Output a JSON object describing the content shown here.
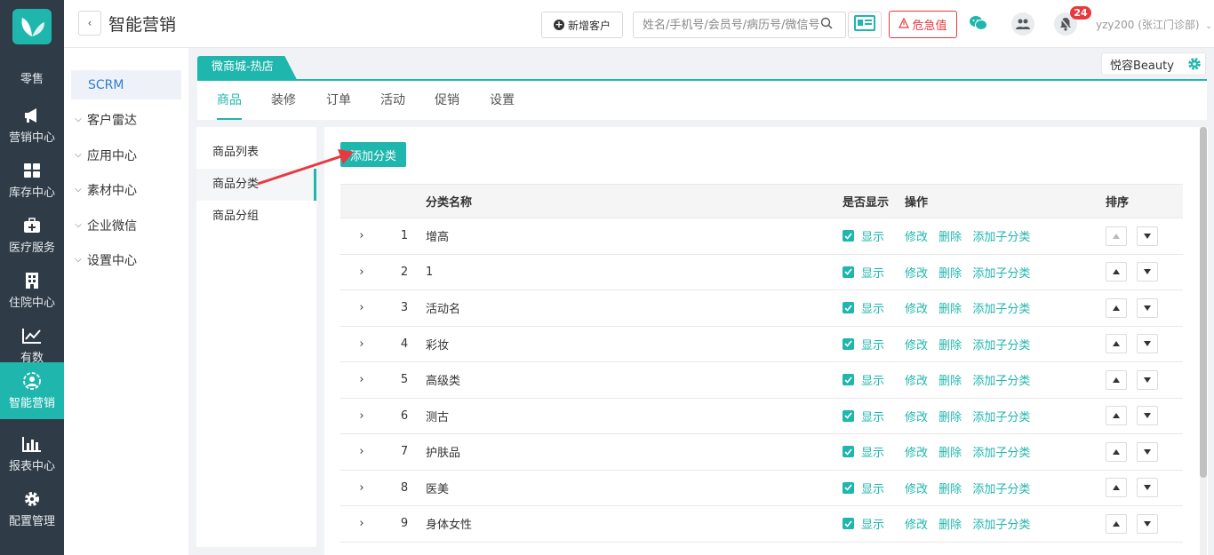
{
  "rail": {
    "items": [
      {
        "label": "零售",
        "icon": "retail-icon"
      },
      {
        "label": "营销中心",
        "icon": "megaphone-icon"
      },
      {
        "label": "库存中心",
        "icon": "grid-icon"
      },
      {
        "label": "医疗服务",
        "icon": "medical-kit-icon"
      },
      {
        "label": "住院中心",
        "icon": "building-icon"
      },
      {
        "label": "有数",
        "icon": "trend-chart-icon"
      },
      {
        "label": "智能营销",
        "icon": "smart-marketing-icon"
      },
      {
        "label": "报表中心",
        "icon": "bar-chart-icon"
      },
      {
        "label": "配置管理",
        "icon": "gear-icon"
      }
    ],
    "active_index": 6,
    "accent": "#1fb6ad"
  },
  "header": {
    "title": "智能营销",
    "new_customer": "新增客户",
    "search_placeholder": "姓名/手机号/会员号/病历号/微信号",
    "danger_label": "危急值",
    "notify_count": "24",
    "user": "yzy200 (张江门诊部)"
  },
  "subnav": {
    "items": [
      {
        "label": "SCRM",
        "active": true
      },
      {
        "label": "客户雷达"
      },
      {
        "label": "应用中心"
      },
      {
        "label": "素材中心"
      },
      {
        "label": "企业微信"
      },
      {
        "label": "设置中心"
      }
    ]
  },
  "shop": {
    "tag": "微商城-热店",
    "org": "悦容Beauty"
  },
  "tabs": [
    "商品",
    "装修",
    "订单",
    "活动",
    "促销",
    "设置"
  ],
  "side_menu": [
    "商品列表",
    "商品分类",
    "商品分组"
  ],
  "toolbar": {
    "add_category": "添加分类"
  },
  "table": {
    "headers": {
      "name": "分类名称",
      "show": "是否显示",
      "ops": "操作",
      "sort": "排序"
    },
    "show_label": "显示",
    "ops": [
      "修改",
      "删除",
      "添加子分类"
    ],
    "rows": [
      {
        "idx": "1",
        "name": "增高"
      },
      {
        "idx": "2",
        "name": "1"
      },
      {
        "idx": "3",
        "name": "活动名"
      },
      {
        "idx": "4",
        "name": "彩妆"
      },
      {
        "idx": "5",
        "name": "高级类"
      },
      {
        "idx": "6",
        "name": "测古"
      },
      {
        "idx": "7",
        "name": "护肤品"
      },
      {
        "idx": "8",
        "name": "医美"
      },
      {
        "idx": "9",
        "name": "身体女性"
      }
    ]
  },
  "colors": {
    "accent": "#1fb6ad",
    "danger": "#e8393f",
    "annotation": "#e8393f"
  }
}
